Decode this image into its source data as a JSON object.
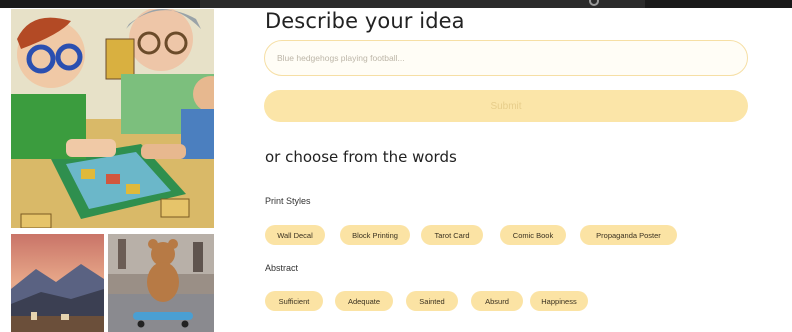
{
  "form": {
    "title": "Describe your idea",
    "input_placeholder": "Blue hedgehogs playing football...",
    "submit_label": "Submit",
    "subtitle": "or choose from the words"
  },
  "sections": [
    {
      "label": "Print Styles",
      "chips": [
        "Wall Decal",
        "Block Printing",
        "Tarot Card",
        "Comic Book",
        "Propaganda Poster"
      ]
    },
    {
      "label": "Abstract",
      "chips": [
        "Sufficient",
        "Adequate",
        "Sainted",
        "Absurd",
        "Happiness"
      ]
    }
  ],
  "colors": {
    "accent": "#fbe3a4",
    "input_border": "#f6dfa5",
    "submit_text": "#e7cd8a"
  }
}
